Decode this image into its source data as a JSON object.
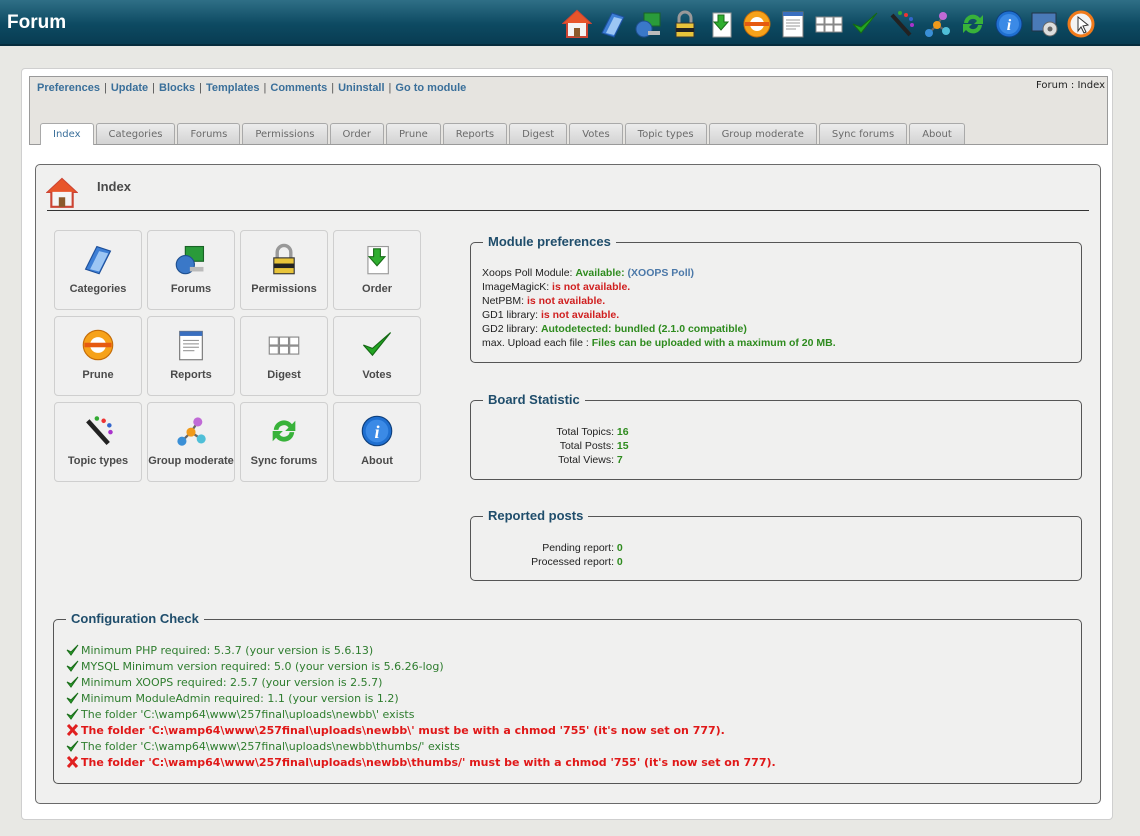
{
  "header": {
    "title": "Forum"
  },
  "toolbar_icons": [
    "home-icon",
    "categories-icon",
    "forums-icon",
    "permissions-lock-icon",
    "order-icon",
    "prune-icon",
    "reports-icon",
    "digest-icon",
    "votes-check-icon",
    "topic-types-icon",
    "group-moderate-icon",
    "sync-forums-icon",
    "about-info-icon",
    "preferences-gear-icon",
    "logout-icon"
  ],
  "menu": {
    "links": [
      "Preferences",
      "Update",
      "Blocks",
      "Templates",
      "Comments",
      "Uninstall",
      "Go to module"
    ],
    "breadcrumb": "Forum : Index"
  },
  "tabs": [
    "Index",
    "Categories",
    "Forums",
    "Permissions",
    "Order",
    "Prune",
    "Reports",
    "Digest",
    "Votes",
    "Topic types",
    "Group moderate",
    "Sync forums",
    "About"
  ],
  "page": {
    "title": "Index"
  },
  "grid": [
    {
      "label": "Categories",
      "icon": "categories-icon"
    },
    {
      "label": "Forums",
      "icon": "forums-icon"
    },
    {
      "label": "Permissions",
      "icon": "permissions-lock-icon"
    },
    {
      "label": "Order",
      "icon": "order-icon"
    },
    {
      "label": "Prune",
      "icon": "prune-icon"
    },
    {
      "label": "Reports",
      "icon": "reports-icon"
    },
    {
      "label": "Digest",
      "icon": "digest-icon"
    },
    {
      "label": "Votes",
      "icon": "votes-check-icon"
    },
    {
      "label": "Topic types",
      "icon": "topic-types-icon"
    },
    {
      "label": "Group moderate",
      "icon": "group-moderate-icon"
    },
    {
      "label": "Sync forums",
      "icon": "sync-forums-icon"
    },
    {
      "label": "About",
      "icon": "about-info-icon"
    }
  ],
  "module_prefs": {
    "legend": "Module preferences",
    "poll_label": "Xoops Poll Module: ",
    "poll_status": "Available:",
    "poll_name": "(XOOPS Poll)",
    "imagick_label": "ImageMagicK: ",
    "imagick_status": "is not available.",
    "netpbm_label": "NetPBM: ",
    "netpbm_status": "is not available.",
    "gd1_label": "GD1 library: ",
    "gd1_status": "is not available.",
    "gd2_label": "GD2 library: ",
    "gd2_status": "Autodetected: bundled (2.1.0 compatible)",
    "upload_label": "max. Upload each file : ",
    "upload_status": "Files can be uploaded with a maximum of 20 MB."
  },
  "board_stats": {
    "legend": "Board Statistic",
    "rows": [
      {
        "label": "Total Topics:",
        "value": "16"
      },
      {
        "label": "Total Posts:",
        "value": "15"
      },
      {
        "label": "Total Views:",
        "value": "7"
      }
    ]
  },
  "reported": {
    "legend": "Reported posts",
    "rows": [
      {
        "label": "Pending report:",
        "value": "0"
      },
      {
        "label": "Processed report:",
        "value": "0"
      }
    ]
  },
  "config": {
    "legend": "Configuration Check",
    "lines": [
      {
        "ok": true,
        "text": "Minimum PHP required: 5.3.7 (your version is 5.6.13)"
      },
      {
        "ok": true,
        "text": "MYSQL Minimum version required: 5.0 (your version is 5.6.26-log)"
      },
      {
        "ok": true,
        "text": "Minimum XOOPS required: 2.5.7 (your version is 2.5.7)"
      },
      {
        "ok": true,
        "text": "Minimum ModuleAdmin required: 1.1 (your version is 1.2)"
      },
      {
        "ok": true,
        "text": "The folder 'C:\\wamp64\\www\\257final\\uploads\\newbb\\' exists"
      },
      {
        "ok": false,
        "text": "The folder 'C:\\wamp64\\www\\257final\\uploads\\newbb\\' must be with a chmod '755' (it's now set on 777)."
      },
      {
        "ok": true,
        "text": "The folder 'C:\\wamp64\\www\\257final\\uploads\\newbb\\thumbs/' exists"
      },
      {
        "ok": false,
        "text": "The folder 'C:\\wamp64\\www\\257final\\uploads\\newbb\\thumbs/' must be with a chmod '755' (it's now set on 777)."
      }
    ]
  },
  "colors": {
    "header": "#0d4a62",
    "ok": "#2e8b1e",
    "error": "#d02020",
    "link": "#3a6f9a"
  }
}
